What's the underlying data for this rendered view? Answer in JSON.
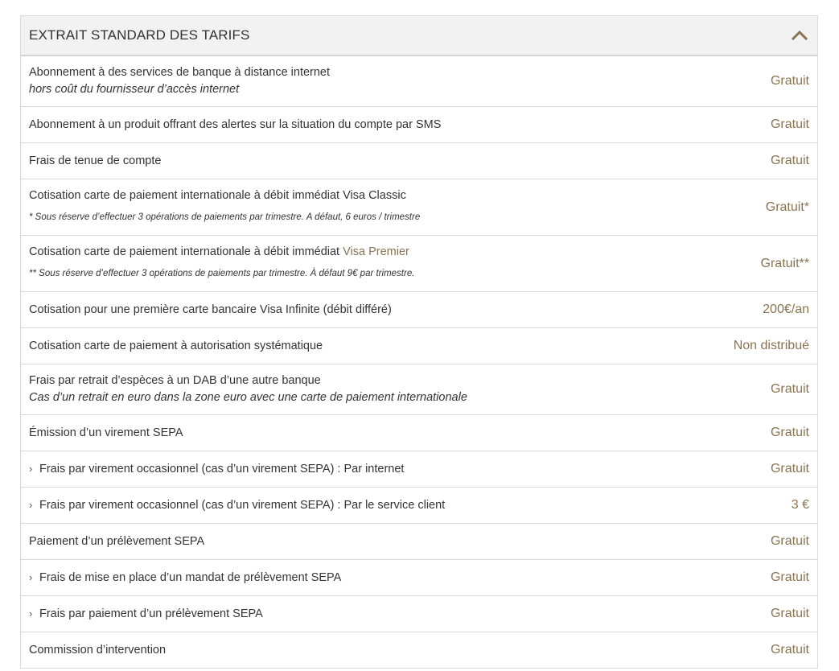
{
  "panel": {
    "title": "EXTRAIT STANDARD DES TARIFS",
    "collapse_icon": "chevron-up-icon",
    "accent_color": "#8a7350"
  },
  "rows": [
    {
      "label": "Abonnement à des services de banque à distance internet",
      "sublabel": "hors coût du fournisseur d’accès internet",
      "value": "Gratuit"
    },
    {
      "label": "Abonnement à un produit offrant des alertes sur la situation du compte par SMS",
      "value": "Gratuit"
    },
    {
      "label": "Frais de tenue de compte",
      "value": "Gratuit"
    },
    {
      "label": "Cotisation carte de paiement internationale à débit immédiat Visa Classic",
      "note": "* Sous réserve d’effectuer 3 opérations de paiements par trimestre. A défaut, 6 euros / trimestre",
      "value": "Gratuit*"
    },
    {
      "label_prefix": "Cotisation carte de paiement internationale à débit immédiat ",
      "label_link": "Visa Premier",
      "note": "** Sous réserve d’effectuer 3 opérations de paiements par trimestre. À défaut 9€ par trimestre.",
      "value": "Gratuit**"
    },
    {
      "label": "Cotisation pour une première carte bancaire Visa Infinite (débit différé)",
      "value": "200€/an"
    },
    {
      "label": "Cotisation carte de paiement à autorisation systématique",
      "value": "Non distribué"
    },
    {
      "label": "Frais par retrait d’espèces à un DAB d’une autre banque",
      "sublabel": "Cas d’un retrait en euro dans la zone euro avec une carte de paiement internationale",
      "value": "Gratuit"
    },
    {
      "label": "Émission d’un virement SEPA",
      "value": "Gratuit"
    },
    {
      "label": "Frais par virement occasionnel (cas d’un virement SEPA) : Par internet",
      "value": "Gratuit"
    },
    {
      "label": "Frais par virement occasionnel (cas d’un virement SEPA) : Par le service client",
      "value": "3 €"
    },
    {
      "label": "Paiement d’un prélèvement SEPA",
      "value": "Gratuit"
    },
    {
      "label": "Frais de mise en place d’un mandat de prélèvement SEPA",
      "value": "Gratuit"
    },
    {
      "label": "Frais par paiement d’un prélèvement SEPA",
      "value": "Gratuit"
    },
    {
      "label": "Commission d’intervention",
      "value": "Gratuit"
    }
  ]
}
